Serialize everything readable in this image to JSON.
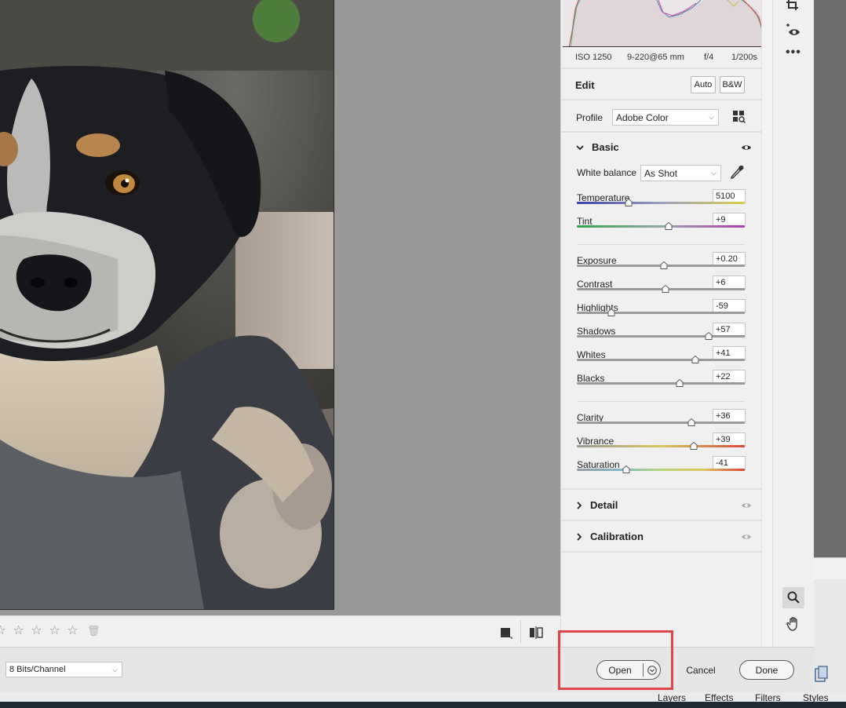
{
  "metadata": {
    "iso": "ISO 1250",
    "lens": "9-220@65 mm",
    "aperture": "f/4",
    "shutter": "1/200s"
  },
  "edit": {
    "title": "Edit",
    "auto_label": "Auto",
    "bw_label": "B&W"
  },
  "profile": {
    "label": "Profile",
    "value": "Adobe Color"
  },
  "basic": {
    "title": "Basic",
    "white_balance_label": "White balance",
    "white_balance_value": "As Shot",
    "sliders": [
      {
        "name": "Temperature",
        "value": "5100",
        "level": 0.31
      },
      {
        "name": "Tint",
        "value": "+9",
        "level": 0.545
      },
      {
        "name": "Exposure",
        "value": "+0.20",
        "level": 0.52
      },
      {
        "name": "Contrast",
        "value": "+6",
        "level": 0.53
      },
      {
        "name": "Highlights",
        "value": "-59",
        "level": 0.205
      },
      {
        "name": "Shadows",
        "value": "+57",
        "level": 0.785
      },
      {
        "name": "Whites",
        "value": "+41",
        "level": 0.705
      },
      {
        "name": "Blacks",
        "value": "+22",
        "level": 0.61
      },
      {
        "name": "Clarity",
        "value": "+36",
        "level": 0.68
      },
      {
        "name": "Vibrance",
        "value": "+39",
        "level": 0.695
      },
      {
        "name": "Saturation",
        "value": "-41",
        "level": 0.295
      }
    ]
  },
  "sections": {
    "detail": "Detail",
    "calibration": "Calibration"
  },
  "footer": {
    "bit_depth": "8 Bits/Channel",
    "open": "Open",
    "cancel": "Cancel",
    "done": "Done"
  },
  "underlying_tabs": [
    "Layers",
    "Effects",
    "Filters",
    "Styles"
  ],
  "colors": {
    "highlight_box": "#e0454a",
    "panel_bg": "#f0f0f0",
    "canvas_bg": "#989898"
  }
}
